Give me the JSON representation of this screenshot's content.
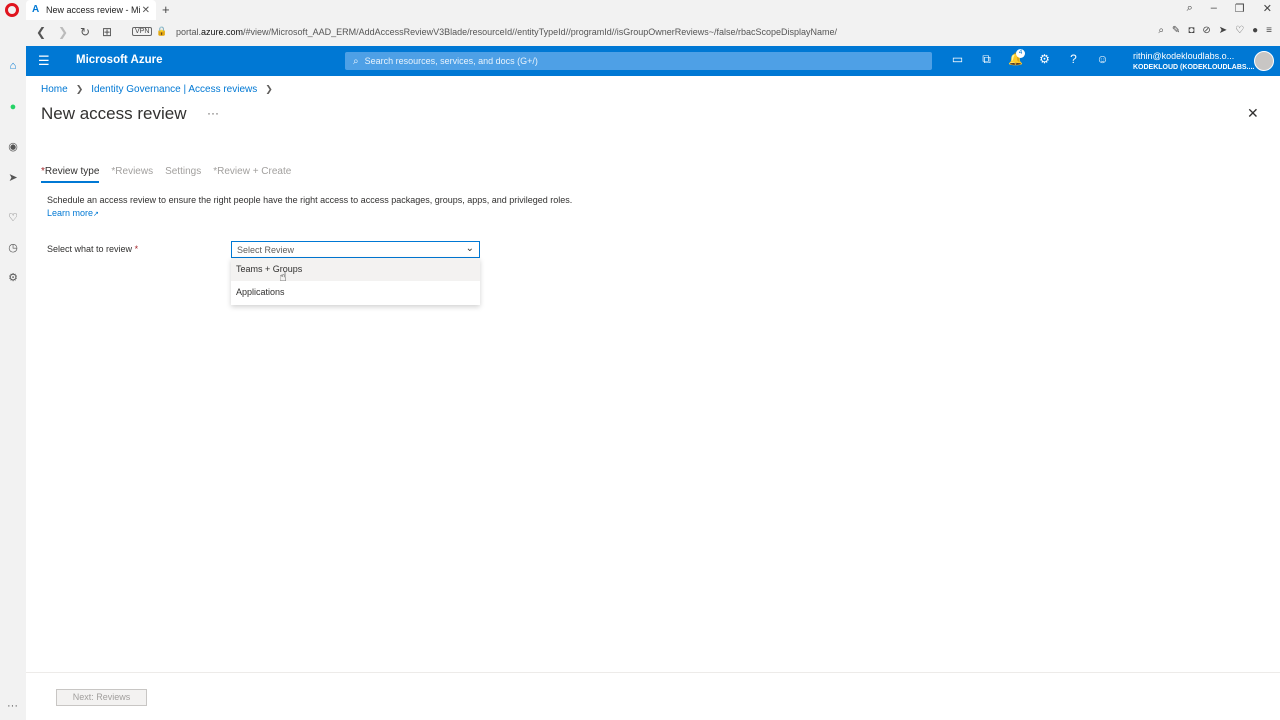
{
  "browser": {
    "tab_title": "New access review - Micro",
    "url_prefix": "portal.",
    "url_domain": "azure.com",
    "url_rest": "/#view/Microsoft_AAD_ERM/AddAccessReviewV3Blade/resourceId//entityTypeId//programId//isGroupOwnerReviews~/false/rbacScopeDisplayName/",
    "vpn_label": "VPN"
  },
  "header": {
    "brand": "Microsoft Azure",
    "search_placeholder": "Search resources, services, and docs (G+/)",
    "notification_count": "4",
    "account_email": "rithin@kodekloudlabs.o...",
    "account_tenant": "KODEKLOUD (KODEKLOUDLABS...."
  },
  "breadcrumb": {
    "home": "Home",
    "section": "Identity Governance | Access reviews"
  },
  "page": {
    "title": "New access review",
    "more": "···"
  },
  "tabs": [
    {
      "label": "Review type",
      "required": true,
      "active": true
    },
    {
      "label": "Reviews",
      "required": true,
      "active": false
    },
    {
      "label": "Settings",
      "required": false,
      "active": false
    },
    {
      "label": "Review + Create",
      "required": true,
      "active": false
    }
  ],
  "form": {
    "description": "Schedule an access review to ensure the right people have the right access to access packages, groups, apps, and privileged roles.",
    "learn_more": "Learn more",
    "select_label": "Select what to review",
    "select_placeholder": "Select Review",
    "options": [
      "Teams + Groups",
      "Applications"
    ]
  },
  "footer": {
    "next_label": "Next: Reviews"
  },
  "colors": {
    "accent": "#0078d4",
    "required": "#a4262c"
  }
}
